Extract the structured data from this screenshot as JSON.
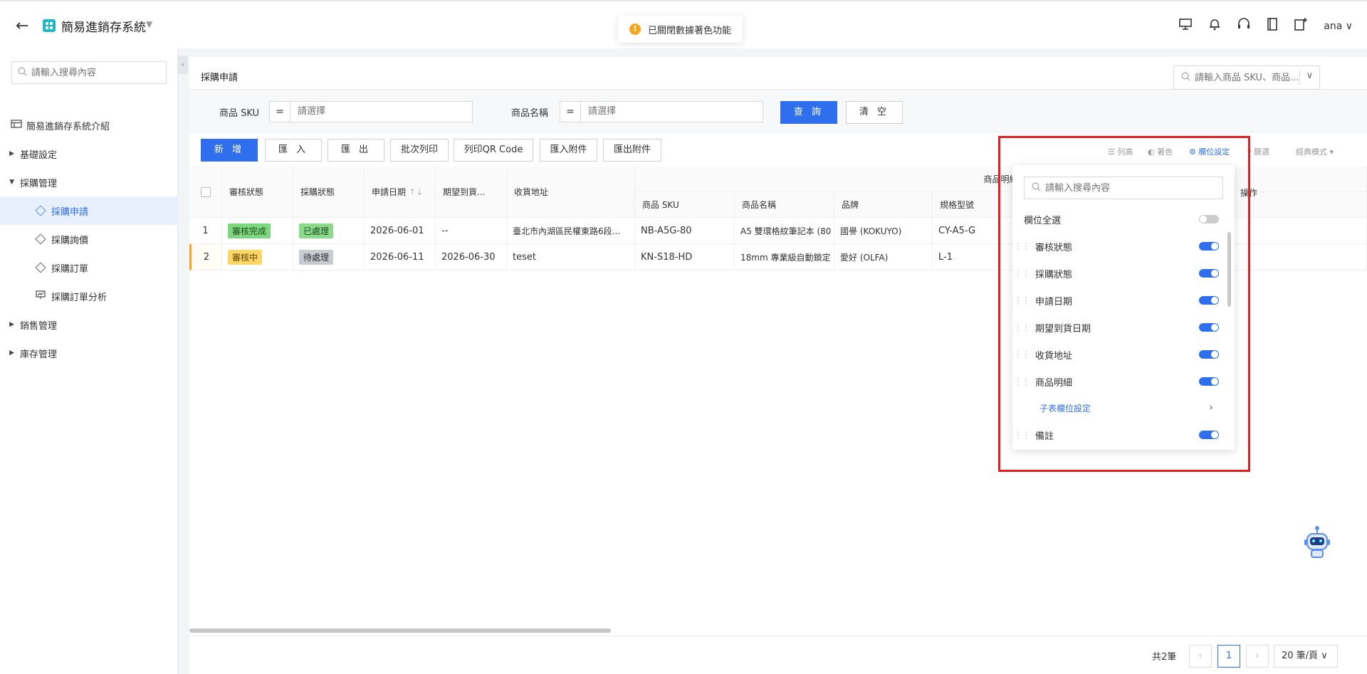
{
  "header": {
    "app_title": "簡易進銷存系統",
    "toast": "已關閉數據著色功能",
    "user": "ana"
  },
  "sidebar": {
    "search_placeholder": "請輸入搜尋內容",
    "intro": "簡易進銷存系統介紹",
    "items": [
      {
        "label": "基礎設定"
      },
      {
        "label": "採購管理"
      },
      {
        "label": "採購申請"
      },
      {
        "label": "採購詢價"
      },
      {
        "label": "採購訂單"
      },
      {
        "label": "採購訂單分析"
      },
      {
        "label": "銷售管理"
      },
      {
        "label": "庫存管理"
      }
    ]
  },
  "main": {
    "tab": "採購申請",
    "global_search_placeholder": "請輸入商品 SKU、商品...",
    "filters": {
      "sku_label": "商品 SKU",
      "name_label": "商品名稱",
      "op": "=",
      "placeholder": "請選擇",
      "query": "查 詢",
      "clear": "清 空"
    },
    "toolbar": {
      "add": "新 增",
      "import": "匯 入",
      "export": "匯 出",
      "batch_print": "批次列印",
      "print_qr": "列印QR Code",
      "import_attach": "匯入附件",
      "export_attach": "匯出附件",
      "row_height": "列高",
      "coloring": "著色",
      "column_settings": "欄位設定",
      "filter": "篩選",
      "mode": "經典模式"
    },
    "table": {
      "headers": {
        "review": "審核狀態",
        "purchase": "採購狀態",
        "apply_date": "申請日期",
        "expect_date": "期望到貨...",
        "address": "收貨地址",
        "detail_group": "商品明細",
        "sku": "商品 SKU",
        "name": "商品名稱",
        "brand": "品牌",
        "spec": "規格型號",
        "ops": "操作"
      },
      "rows": [
        {
          "idx": "1",
          "review": "審核完成",
          "purchase": "已處理",
          "apply_date": "2026-06-01",
          "expect_date": "--",
          "address": "臺北市內湖區民權東路6段...",
          "sku": "NB-A5G-80",
          "name": "A5 雙環格紋筆記本 (80",
          "brand": "國譽 (KOKUYO)",
          "spec": "CY-A5-G"
        },
        {
          "idx": "2",
          "review": "審核中",
          "purchase": "待處理",
          "apply_date": "2026-06-11",
          "expect_date": "2026-06-30",
          "address": "teset",
          "sku": "KN-S18-HD",
          "name": "18mm 專業級自動鎖定",
          "brand": "愛好 (OLFA)",
          "spec": "L-1"
        }
      ]
    },
    "pager": {
      "total": "共2筆",
      "page": "1",
      "size": "20 筆/頁"
    }
  },
  "column_panel": {
    "search_placeholder": "請輸入搜尋內容",
    "select_all": "欄位全選",
    "columns": [
      {
        "label": "審核狀態"
      },
      {
        "label": "採購狀態"
      },
      {
        "label": "申請日期"
      },
      {
        "label": "期望到貨日期"
      },
      {
        "label": "收貨地址"
      },
      {
        "label": "商品明細"
      }
    ],
    "sub_settings": "子表欄位設定",
    "remark": "備註"
  }
}
